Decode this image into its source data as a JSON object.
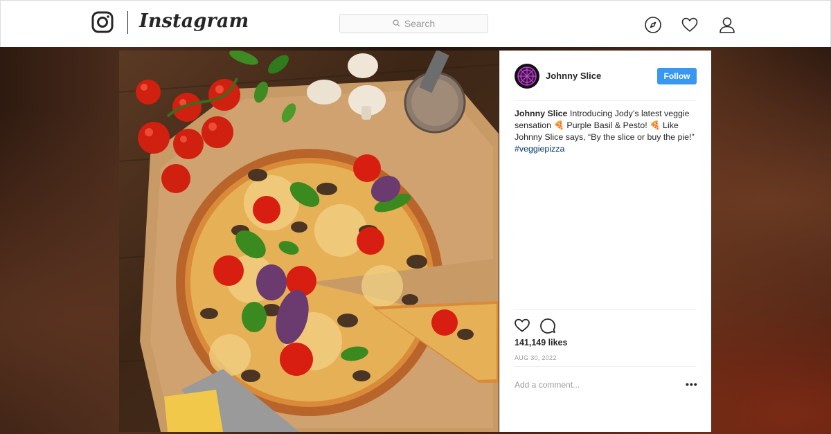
{
  "header": {
    "brand": "Instagram",
    "search_placeholder": "Search",
    "icons": [
      "instagram-logo-icon",
      "search-icon",
      "compass-icon",
      "heart-icon",
      "user-icon"
    ]
  },
  "post": {
    "username": "Johnny Slice",
    "follow_label": "Follow",
    "caption": {
      "author": "Johnny Slice",
      "text": "Introducing Jody’s latest veggie sensation 🍕 Purple Basil & Pesto! 🍕 Like Johnny Slice says, “By the slice or buy the pie!”",
      "hashtag": "#veggiepizza"
    },
    "likes": "141,149 likes",
    "date": "AUG 30, 2022",
    "comment_placeholder": "Add a comment...",
    "more_label": "•••"
  },
  "colors": {
    "follow_button": "#3897f0",
    "hashtag": "#003569",
    "border": "#dbdbdb",
    "text": "#262626",
    "muted": "#999999"
  }
}
